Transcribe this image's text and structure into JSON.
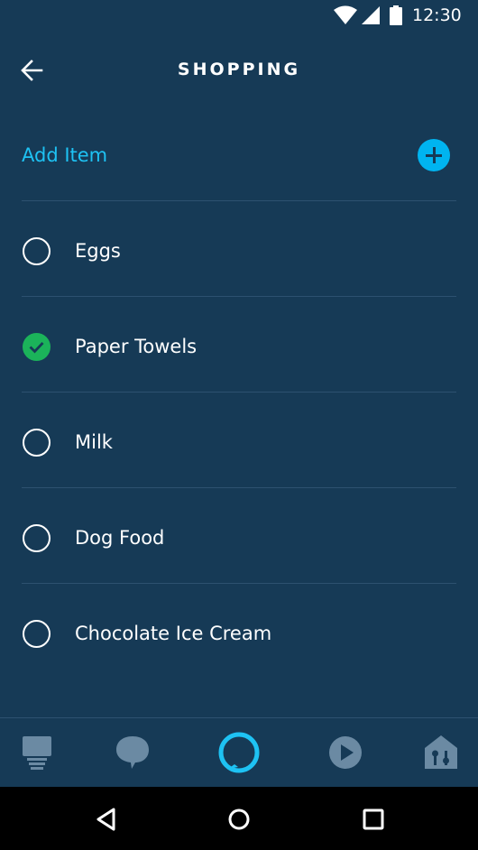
{
  "status_bar": {
    "time": "12:30"
  },
  "header": {
    "title": "SHOPPING"
  },
  "add_item": {
    "label": "Add Item"
  },
  "items": [
    {
      "label": "Eggs",
      "checked": false
    },
    {
      "label": "Paper Towels",
      "checked": true
    },
    {
      "label": "Milk",
      "checked": false
    },
    {
      "label": "Dog Food",
      "checked": false
    },
    {
      "label": "Chocolate Ice Cream",
      "checked": false
    }
  ],
  "bottom_nav": [
    {
      "icon": "home-icon"
    },
    {
      "icon": "chat-bubble-icon"
    },
    {
      "icon": "alexa-ring-icon"
    },
    {
      "icon": "play-icon"
    },
    {
      "icon": "smart-home-icon"
    }
  ],
  "colors": {
    "background": "#163a56",
    "accent": "#1ec2f3",
    "checked": "#1bb35a",
    "divider": "#2d5170",
    "nav_icon": "#6b8aa3"
  }
}
